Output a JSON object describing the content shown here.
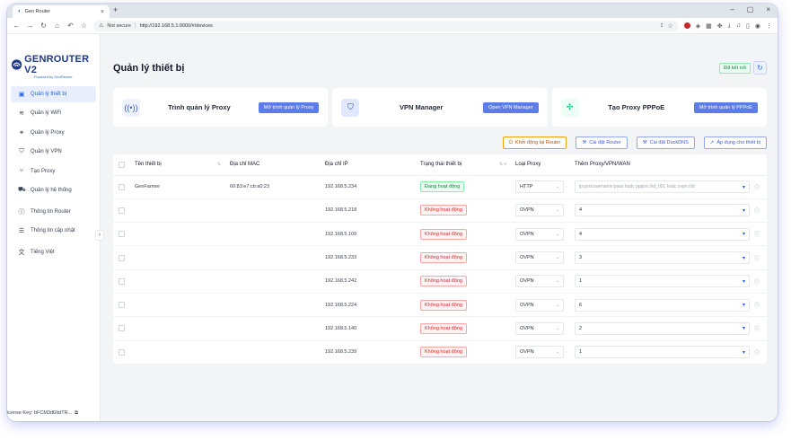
{
  "browser": {
    "tab_title": "Gen Router",
    "security": "Not secure",
    "url": "http://192.168.5.1:9000/#/devices"
  },
  "sidebar": {
    "logo_text": "GENROUTER V2",
    "logo_sub": "Powered by GenFarmer",
    "items": [
      {
        "label": "Quản lý thiết bị",
        "icon": "devices-icon"
      },
      {
        "label": "Quản lý WiFi",
        "icon": "wifi-icon"
      },
      {
        "label": "Quản lý Proxy",
        "icon": "proxy-icon"
      },
      {
        "label": "Quản lý VPN",
        "icon": "shield-icon"
      },
      {
        "label": "Tạo Proxy",
        "icon": "branch-icon"
      },
      {
        "label": "Quản lý hệ thống",
        "icon": "truck-icon"
      },
      {
        "label": "Thông tin Router",
        "icon": "info-icon"
      },
      {
        "label": "Thông tin cập nhật",
        "icon": "layers-icon"
      },
      {
        "label": "Tiếng Việt",
        "icon": "translate-icon"
      }
    ],
    "license": "icense Key: bFCM3d6ItdTR..."
  },
  "header": {
    "title": "Quản lý thiết bị",
    "status": "Đã kết nối"
  },
  "cards": [
    {
      "title": "Trình quản lý Proxy",
      "button": "Mở trình quản lý Proxy"
    },
    {
      "title": "VPN Manager",
      "button": "Open VPN Manager"
    },
    {
      "title": "Tạo Proxy PPPoE",
      "button": "Mở trình quản lý PPPoE"
    }
  ],
  "actions": {
    "restart": "Khởi động lại Router",
    "install_router": "Cài đặt Router",
    "install_duckdns": "Cài đặt DuckDNS",
    "apply_devices": "Áp dụng cho thiết bị"
  },
  "table": {
    "headers": [
      "Tên thiết bị",
      "Địa chỉ MAC",
      "Địa chỉ IP",
      "Trạng thái thiết bị",
      "Loại Proxy",
      "Thêm Proxy/VPN/WAN"
    ],
    "placeholder": "ip:port:username:pass hoặc pppoe://id_001 hoặc ovpn://id",
    "rows": [
      {
        "name": "GenFarmer",
        "mac": "60:83:e7:cb:a0:23",
        "ip": "192.168.5.234",
        "status": "Đang hoạt động",
        "ok": true,
        "type": "HTTP",
        "value": ""
      },
      {
        "name": "",
        "mac": "",
        "ip": "192.168.5.218",
        "status": "Không hoạt động",
        "ok": false,
        "type": "OVPN",
        "value": "4"
      },
      {
        "name": "",
        "mac": "",
        "ip": "192.168.5.109",
        "status": "Không hoạt động",
        "ok": false,
        "type": "OVPN",
        "value": "4"
      },
      {
        "name": "",
        "mac": "",
        "ip": "192.168.5.233",
        "status": "Không hoạt động",
        "ok": false,
        "type": "OVPN",
        "value": "3"
      },
      {
        "name": "",
        "mac": "",
        "ip": "192.168.5.242",
        "status": "Không hoạt động",
        "ok": false,
        "type": "OVPN",
        "value": "1"
      },
      {
        "name": "",
        "mac": "",
        "ip": "192.168.5.224",
        "status": "Không hoạt động",
        "ok": false,
        "type": "OVPN",
        "value": "6"
      },
      {
        "name": "",
        "mac": "",
        "ip": "192.168.5.140",
        "status": "Không hoạt động",
        "ok": false,
        "type": "OVPN",
        "value": "2"
      },
      {
        "name": "",
        "mac": "",
        "ip": "192.168.5.239",
        "status": "Không hoạt động",
        "ok": false,
        "type": "OVPN",
        "value": "1"
      }
    ]
  },
  "colors": {
    "accent": "#2563eb",
    "button": "#5b7ce9",
    "ok": "#15803d",
    "bad": "#dc2626"
  }
}
